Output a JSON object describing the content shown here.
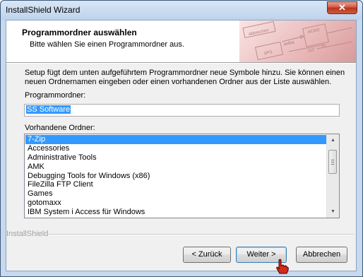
{
  "window": {
    "title": "InstallShield Wizard",
    "close_label": "✕"
  },
  "header": {
    "title": "Programmordner auswählen",
    "subtitle": "Bitte wählen Sie einen Programmordner aus.",
    "art_labels": [
      "Abbrechen",
      "SPS",
      "ACKO",
      "deBiä",
      "112"
    ]
  },
  "body": {
    "intro": "Setup fügt dem unten aufgeführtem Programmordner neue Symbole hinzu. Sie können einen neuen Ordnernamen eingeben oder einen vorhandenen Ordner aus der Liste auswählen.",
    "program_folder_label": "Programmordner:",
    "program_folder_value": "SS Software",
    "existing_folders_label": "Vorhandene Ordner:",
    "existing_folders": [
      "7-Zip",
      "Accessories",
      "Administrative Tools",
      "AMK",
      "Debugging Tools for Windows (x86)",
      "FileZilla FTP Client",
      "Games",
      "gotomaxx",
      "IBM System i Access für Windows"
    ],
    "selected_index": 0
  },
  "footer": {
    "brand": "InstallShield",
    "back_label": "< Zurück",
    "next_label": "Weiter >",
    "cancel_label": "Abbrechen"
  },
  "colors": {
    "selection": "#3399ff",
    "title_bar": "#c7d9ee",
    "close_button": "#c9452f"
  }
}
